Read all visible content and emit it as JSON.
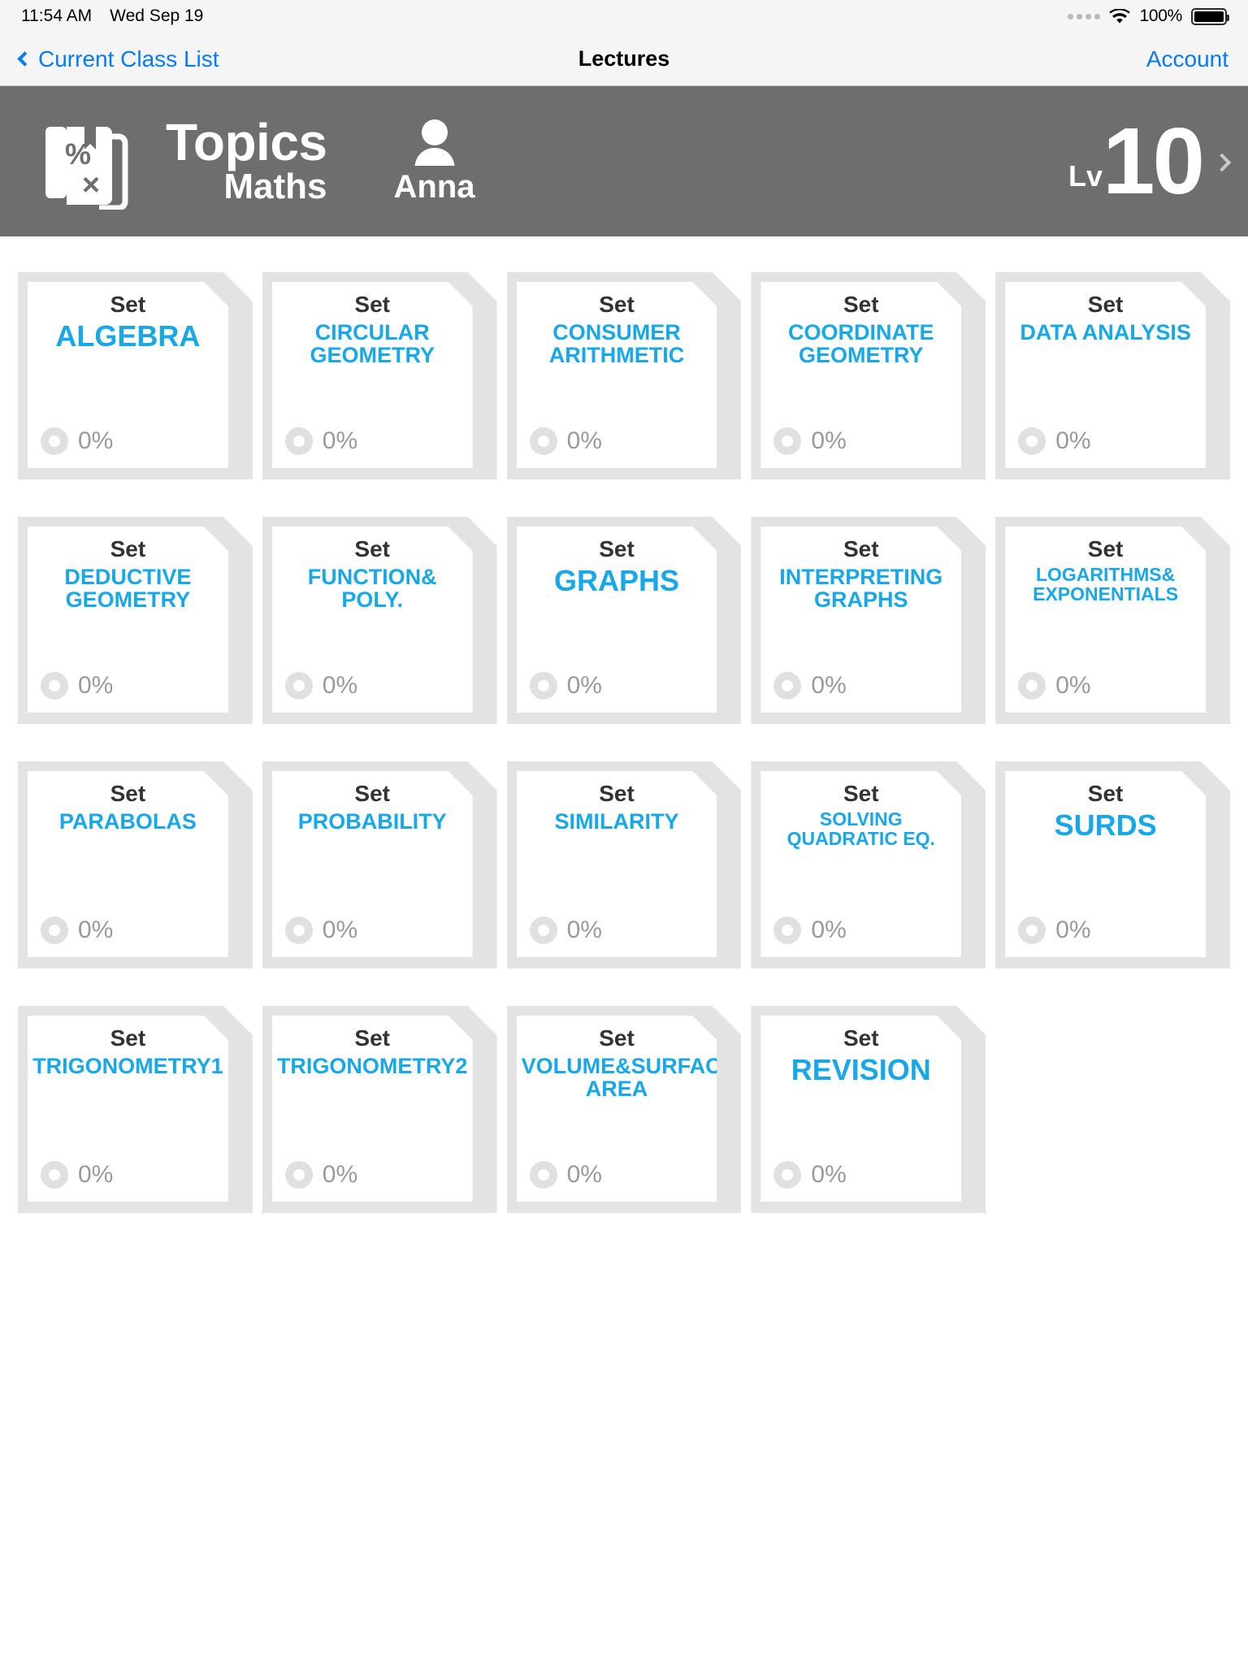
{
  "status_bar": {
    "time": "11:54 AM",
    "date": "Wed Sep 19",
    "battery_percent": "100%",
    "wifi_icon": "wifi-icon",
    "battery_icon": "battery-full-icon",
    "signal_dots_icon": "signal-dots-icon"
  },
  "nav": {
    "back_label": "Current Class List",
    "title": "Lectures",
    "account_label": "Account",
    "back_icon": "chevron-left-icon",
    "link_color": "#057aff"
  },
  "header": {
    "app_icon": "math-book-icon",
    "title": "Topics",
    "subtitle": "Maths",
    "user_icon": "person-icon",
    "user_name": "Anna",
    "level_label": "Lv",
    "level_value": "10",
    "disclosure_icon": "chevron-right-icon",
    "background_color": "#6e6e6e"
  },
  "theme": {
    "accent_color": "#18a8e8",
    "set_label_color": "#333333",
    "card_back_color": "#e3e3e3",
    "progress_text_color": "#9a9a9a"
  },
  "cards": [
    {
      "set_label": "Set",
      "topic": "ALGEBRA",
      "size": "lg",
      "progress": "0%"
    },
    {
      "set_label": "Set",
      "topic": "CIRCULAR GEOMETRY",
      "size": "md",
      "progress": "0%"
    },
    {
      "set_label": "Set",
      "topic": "CONSUMER ARITHMETIC",
      "size": "md",
      "progress": "0%"
    },
    {
      "set_label": "Set",
      "topic": "COORDINATE GEOMETRY",
      "size": "md",
      "progress": "0%"
    },
    {
      "set_label": "Set",
      "topic": "DATA ANALYSIS",
      "size": "md",
      "progress": "0%"
    },
    {
      "set_label": "Set",
      "topic": "DEDUCTIVE GEOMETRY",
      "size": "md",
      "progress": "0%"
    },
    {
      "set_label": "Set",
      "topic": "FUNCTION& POLY.",
      "size": "md",
      "progress": "0%"
    },
    {
      "set_label": "Set",
      "topic": "GRAPHS",
      "size": "lg",
      "progress": "0%"
    },
    {
      "set_label": "Set",
      "topic": "INTERPRETING GRAPHS",
      "size": "md",
      "progress": "0%"
    },
    {
      "set_label": "Set",
      "topic": "LOGARITHMS& EXPONENTIALS",
      "size": "sm",
      "progress": "0%"
    },
    {
      "set_label": "Set",
      "topic": "PARABOLAS",
      "size": "md",
      "progress": "0%"
    },
    {
      "set_label": "Set",
      "topic": "PROBABILITY",
      "size": "md",
      "progress": "0%"
    },
    {
      "set_label": "Set",
      "topic": "SIMILARITY",
      "size": "md",
      "progress": "0%"
    },
    {
      "set_label": "Set",
      "topic": "SOLVING QUADRATIC EQ.",
      "size": "sm",
      "progress": "0%"
    },
    {
      "set_label": "Set",
      "topic": "SURDS",
      "size": "lg",
      "progress": "0%"
    },
    {
      "set_label": "Set",
      "topic": "TRIGONOMETRY1",
      "size": "md",
      "progress": "0%"
    },
    {
      "set_label": "Set",
      "topic": "TRIGONOMETRY2",
      "size": "md",
      "progress": "0%"
    },
    {
      "set_label": "Set",
      "topic": "VOLUME&SURFACE AREA",
      "size": "md",
      "progress": "0%"
    },
    {
      "set_label": "Set",
      "topic": "REVISION",
      "size": "lg",
      "progress": "0%"
    }
  ]
}
